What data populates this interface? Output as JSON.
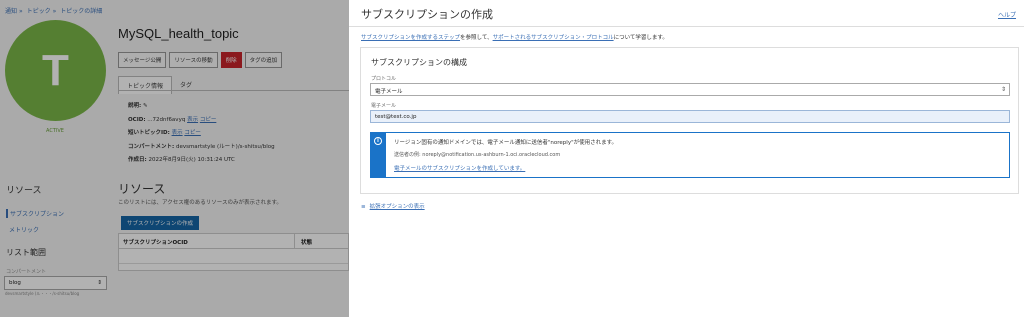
{
  "background": {
    "breadcrumb": [
      "通知",
      "»",
      "トピック",
      "»",
      "トピックの詳細"
    ],
    "avatar_letter": "T",
    "status": "ACTIVE",
    "topic_title": "MySQL_health_topic",
    "actions": [
      "メッセージ公開",
      "リソースの移動",
      "削除",
      "タグの追加"
    ],
    "tabs": [
      "トピック情報",
      "タグ"
    ],
    "info": {
      "description_label": "説明:",
      "ocid_label": "OCID:",
      "ocid_value": "...72dnf6avyq",
      "show": "表示",
      "copy": "コピー",
      "short_ocid_label": "短いトピックID:",
      "compartment_label": "コンパートメント:",
      "compartment_value": "devsmartstyle (ルート)/s-shitsu/blog",
      "created_label": "作成日:",
      "created_value": "2022年8月9日(火) 10:31:24 UTC"
    },
    "resources_side": "リソース",
    "resources_title": "リソース",
    "resources_desc": "このリストには、アクセス権のあるリソースのみが表示されます。",
    "side_items": [
      "サブスクリプション",
      "メトリック"
    ],
    "scope_title": "リスト範囲",
    "compartment_field_label": "コンパートメント",
    "compartment_select": "blog",
    "compartment_path": "devsmartstyle (ル・・・/s-shitsu/blog",
    "create_button": "サブスクリプションの作成",
    "table_headers": [
      "サブスクリプションOCID",
      "状態"
    ]
  },
  "panel": {
    "title": "サブスクリプションの作成",
    "help": "ヘルプ",
    "intro_link1": "サブスクリプションを作成するステップ",
    "intro_mid": "を参照して、",
    "intro_link2": "サポートされるサブスクリプション・プロトコル",
    "intro_end": "について学習します。",
    "section_title": "サブスクリプションの構成",
    "protocol_label": "プロトコル",
    "protocol_value": "電子メール",
    "email_label": "電子メール",
    "email_value": "test@test.co.jp",
    "notice_line1": "リージョン固有の通知ドメインでは、電子メール通知に送信者\"noreply\"が使用されます。",
    "notice_line2": "送信者の例: noreply@notification.us-ashburn-1.oci.oraclecloud.com",
    "notice_link": "電子メールのサブスクリプションを作成しています。",
    "advanced_icon": "≡",
    "advanced_link": "拡張オプションの表示"
  }
}
